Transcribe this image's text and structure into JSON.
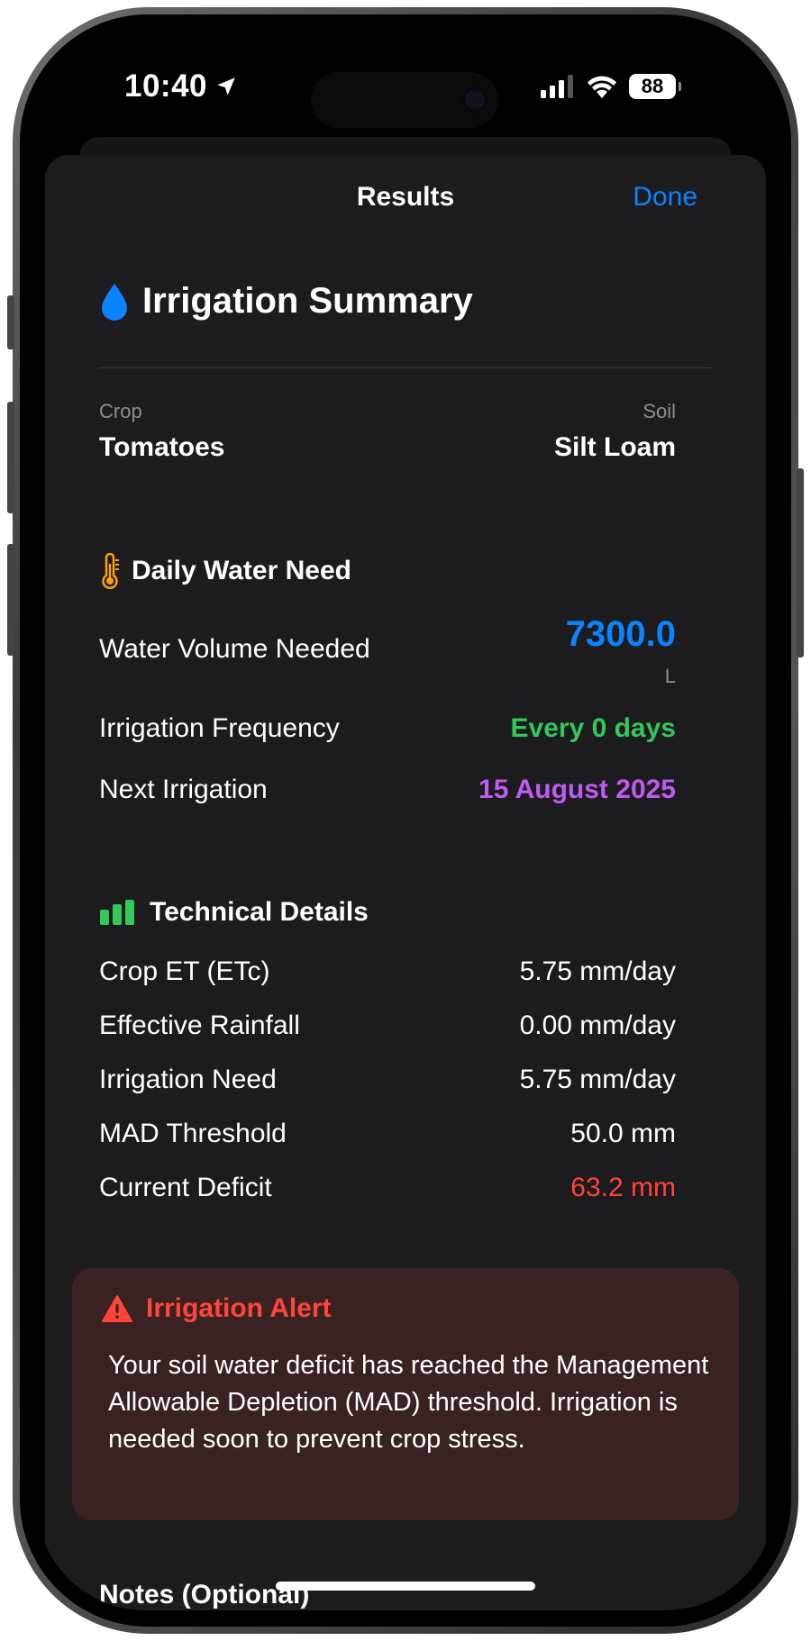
{
  "status_bar": {
    "time": "10:40",
    "battery": "88"
  },
  "nav": {
    "title": "Results",
    "done_label": "Done"
  },
  "summary": {
    "title": "Irrigation Summary",
    "crop_label": "Crop",
    "crop_value": "Tomatoes",
    "soil_label": "Soil",
    "soil_value": "Silt Loam"
  },
  "daily": {
    "title": "Daily Water Need",
    "volume_label": "Water Volume Needed",
    "volume_value": "7300.0",
    "volume_unit": "L",
    "frequency_label": "Irrigation Frequency",
    "frequency_value": "Every 0 days",
    "next_label": "Next Irrigation",
    "next_value": "15 August 2025"
  },
  "technical": {
    "title": "Technical Details",
    "rows": [
      {
        "label": "Crop ET (ETc)",
        "value": "5.75 mm/day"
      },
      {
        "label": "Effective Rainfall",
        "value": "0.00 mm/day"
      },
      {
        "label": "Irrigation Need",
        "value": "5.75 mm/day"
      },
      {
        "label": "MAD Threshold",
        "value": "50.0 mm"
      },
      {
        "label": "Current Deficit",
        "value": "63.2 mm"
      }
    ]
  },
  "alert": {
    "title": "Irrigation Alert",
    "body": "Your soil water deficit has reached the Management Allowable Depletion (MAD) threshold. Irrigation is needed soon to prevent crop stress."
  },
  "notes": {
    "title": "Notes (Optional)"
  },
  "colors": {
    "accent_blue": "#0a84ff",
    "green": "#34c759",
    "purple": "#bf5af2",
    "red": "#ff453a",
    "orange": "#ff9f0a"
  },
  "icons": [
    "location-arrow-icon",
    "cellular-signal-icon",
    "wifi-icon",
    "battery-icon",
    "water-drop-icon",
    "thermometer-icon",
    "bar-chart-icon",
    "warning-triangle-icon"
  ]
}
